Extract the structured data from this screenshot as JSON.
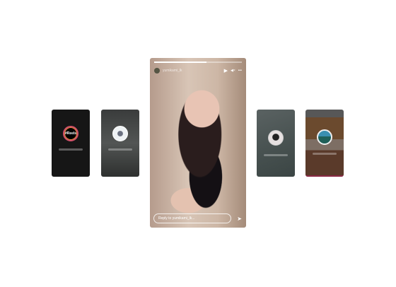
{
  "stories": [
    {
      "label": "#Reels"
    },
    {
      "label": ""
    },
    {
      "label": ""
    },
    {
      "label": ""
    }
  ],
  "main": {
    "progress": 0.6,
    "username": "yumikami_lk",
    "reply_placeholder": "Reply to yumikami_lk...",
    "icons": {
      "play": "▶",
      "mute": "◀×",
      "more": "•••",
      "send": "➤"
    }
  }
}
